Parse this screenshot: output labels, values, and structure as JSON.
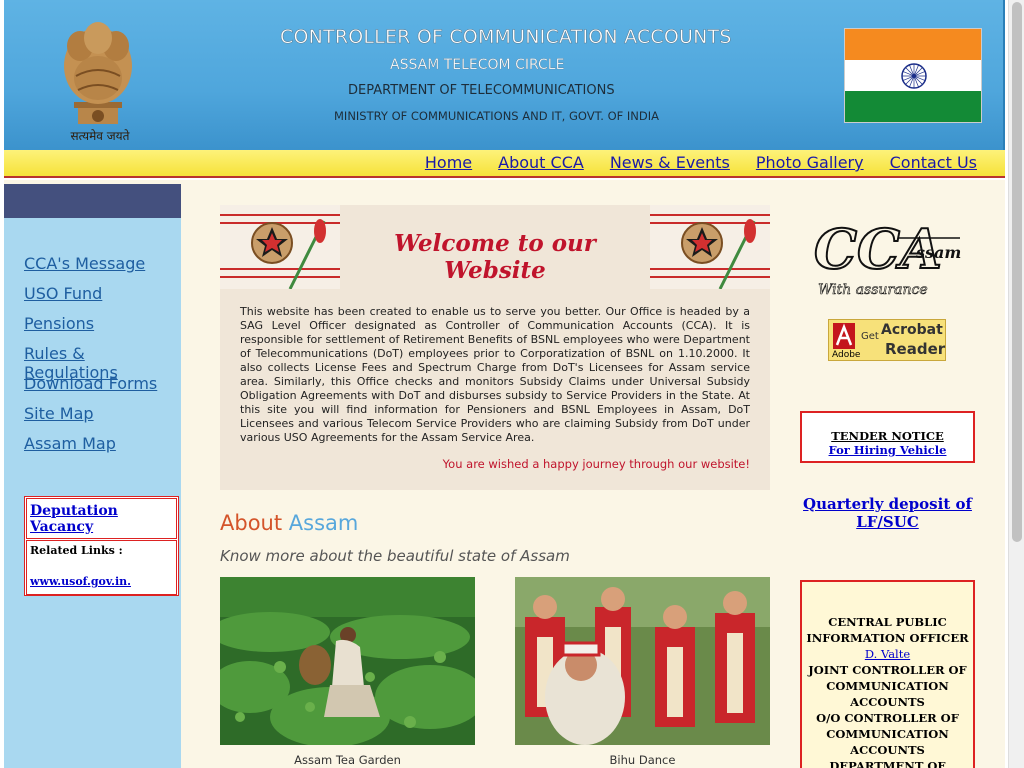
{
  "header": {
    "title_line1": "CONTROLLER OF COMMUNICATION ACCOUNTS",
    "title_line2": "ASSAM TELECOM CIRCLE",
    "title_line3": "DEPARTMENT OF TELECOMMUNICATIONS",
    "title_line4": "MINISTRY OF COMMUNICATIONS AND IT, GOVT. OF INDIA",
    "emblem_motto": "सत्यमेव जयते",
    "emblem_icon": "national-emblem-icon",
    "flag_icon": "indian-flag-icon"
  },
  "nav": {
    "items": [
      "Home",
      "About CCA",
      "News & Events",
      "Photo Gallery",
      "Contact Us"
    ]
  },
  "sidebar": {
    "items": [
      "CCA's Message",
      "USO Fund",
      "Pensions",
      "Rules & Regulations",
      "Download Forms",
      "Site Map",
      "Assam Map"
    ],
    "deputation_label": "Deputation Vacancy",
    "related_label": "Related Links :",
    "related_link": "www.usof.gov.in."
  },
  "main": {
    "welcome": "Welcome to our Website",
    "intro": "This website has been created to enable us to serve you better. Our Office is headed by a SAG Level Officer designated as Controller of Communication Accounts (CCA). It is responsible for settlement of Retirement Benefits of BSNL employees who were Department of Telecommunications (DoT) employees prior to Corporatization of BSNL on 1.10.2000. It also collects License Fees and Spectrum Charge from DoT's Licensees for Assam service area. Similarly, this Office checks and monitors Subsidy Claims under Universal Subsidy Obligation Agreements with DoT and disburses subsidy to Service Providers in the State. At this site you will find information for Pensioners and BSNL Employees in Assam, DoT Licensees and various Telecom Service Providers who are claiming Subsidy from DoT under various USO Agreements for the Assam Service Area.",
    "wish": "You are wished a happy journey through our website!",
    "about_word1": "About",
    "about_word2": "Assam",
    "about_sub": "Know more about the beautiful state of Assam",
    "photo1_caption": "Assam Tea Garden",
    "photo2_caption": "Bihu Dance"
  },
  "right": {
    "logo_cca": "CCA",
    "logo_ssam": "ssam",
    "logo_tagline": "With assurance",
    "acrobat_get": "Get",
    "acrobat_brand": "Adobe",
    "acrobat_title": "Acrobat",
    "acrobat_reader": "Reader",
    "tender_title": "TENDER NOTICE",
    "tender_link": "For Hiring Vehicle",
    "quarterly_link": "Quarterly deposit of LF/SUC",
    "cpio_title": "CENTRAL PUBLIC INFORMATION OFFICER",
    "cpio_name": "D. Valte",
    "cpio_line2": "JOINT CONTROLLER OF COMMUNICATION ACCOUNTS",
    "cpio_line3": "O/O CONTROLLER OF COMMUNICATION ACCOUNTS",
    "cpio_line4": "DEPARTMENT OF"
  },
  "colors": {
    "header_blue": "#4fa6dc",
    "nav_yellow": "#f6e23a",
    "sidebar_blue": "#a9d8f0",
    "accent_red": "#c0142c",
    "link_blue": "#0000cc"
  }
}
